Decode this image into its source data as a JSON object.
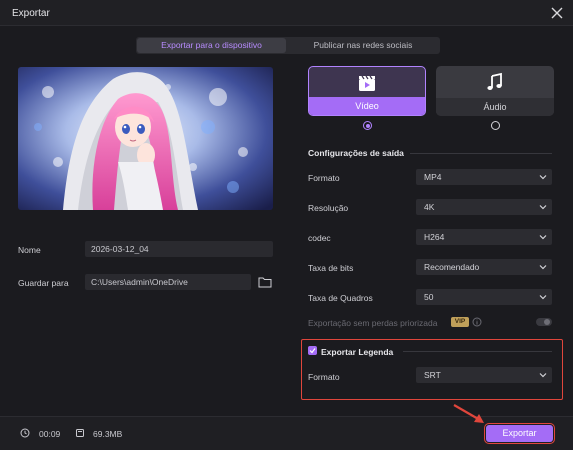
{
  "window": {
    "title": "Exportar"
  },
  "tabs": [
    {
      "label": "Exportar para o dispositivo",
      "active": true
    },
    {
      "label": "Publicar nas redes sociais",
      "active": false
    }
  ],
  "fields": {
    "name_label": "Nome",
    "name_value": "2026-03-12_04",
    "save_label": "Guardar para",
    "save_value": "C:\\Users\\admin\\OneDrive"
  },
  "type_cards": {
    "video_label": "Vídeo",
    "audio_label": "Áudio",
    "selected": "Vídeo"
  },
  "output_settings": {
    "title": "Configurações de saída",
    "rows": [
      {
        "label": "Formato",
        "value": "MP4"
      },
      {
        "label": "Resolução",
        "value": "4K"
      },
      {
        "label": "codec",
        "value": "H264"
      },
      {
        "label": "Taxa de bits",
        "value": "Recomendado"
      },
      {
        "label": "Taxa de Quadros",
        "value": "50"
      }
    ],
    "lossless_label": "Exportação sem perdas priorizada",
    "vip_badge": "VIP",
    "lossless_enabled": false
  },
  "subtitle": {
    "checkbox_label": "Exportar Legenda",
    "checked": true,
    "format_label": "Formato",
    "format_value": "SRT"
  },
  "footer": {
    "duration": "00:09",
    "size": "69.3MB",
    "export_label": "Exportar"
  },
  "colors": {
    "accent": "#a46cf6",
    "highlight": "#e0463c",
    "background": "#1b1b1f"
  }
}
